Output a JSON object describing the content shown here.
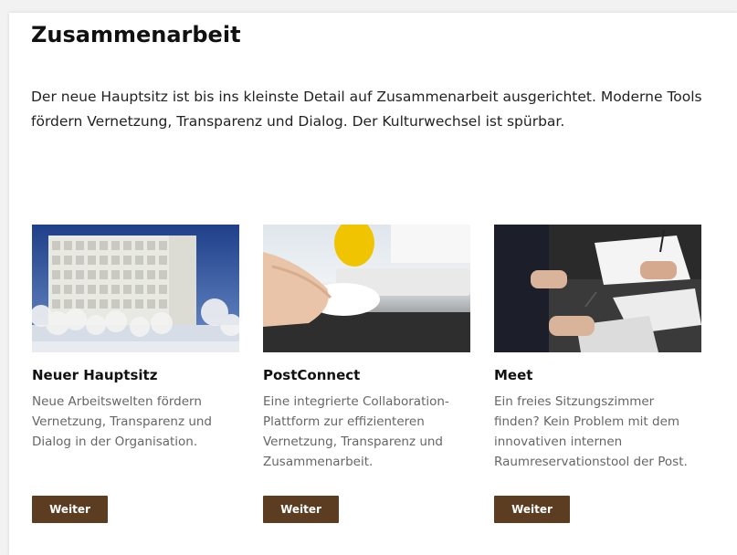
{
  "section": {
    "title": "Zusammenarbeit",
    "intro": "Der neue Hauptsitz ist bis ins kleinste Detail auf Zusammenarbeit ausgerichtet. Moderne Tools fördern Vernetzung, Transparenz und Dialog. Der Kulturwechsel ist spürbar."
  },
  "teasers": [
    {
      "title": "Neuer Hauptsitz",
      "text": "Neue Arbeitswelten fördern Vernetzung, Transparenz und Dialog in der Organisation.",
      "button": "Weiter",
      "image": "building-photo"
    },
    {
      "title": "PostConnect",
      "text": "Eine integrierte Collaboration-Plattform zur effizienteren Vernetzung, Transparenz und Zusammenarbeit.",
      "button": "Weiter",
      "image": "mouse-keyboard-photo"
    },
    {
      "title": "Meet",
      "text": "Ein freies Sitzungszimmer finden? Kein Problem mit dem innovativen internen Raumreservationstool der Post.",
      "button": "Weiter",
      "image": "meeting-photo"
    }
  ],
  "colors": {
    "button": "#5c3d21",
    "background": "#ffffff",
    "text_muted": "#666666"
  }
}
